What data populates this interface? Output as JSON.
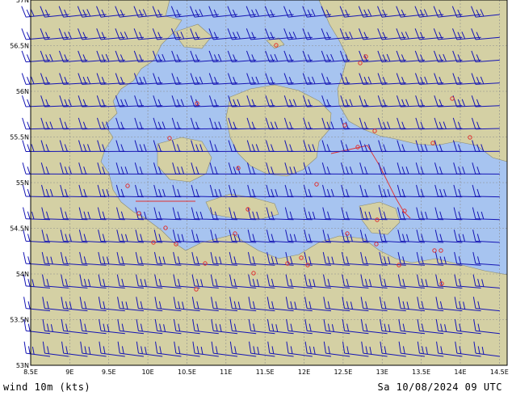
{
  "footer": {
    "left_label": "wind 10m (kts)",
    "right_label": "Sa 10/08/2024 09 UTC"
  },
  "axes": {
    "lon_ticks": [
      "8.5E",
      "9E",
      "9.5E",
      "10E",
      "10.5E",
      "11E",
      "11.5E",
      "12E",
      "12.5E",
      "13E",
      "13.5E",
      "14E",
      "14.5E"
    ],
    "lat_ticks": [
      "57N",
      "56.5N",
      "56N",
      "55.5N",
      "55N",
      "54.5N",
      "54N",
      "53.5N",
      "53N"
    ]
  },
  "colors": {
    "sea": "#a7c4f0",
    "land": "#d4d0a4",
    "barb": "#1414b4",
    "grid": "#8c8c8c",
    "border": "#e03030",
    "station": "#e03030"
  },
  "icons": {
    "wind_barb": "wind-barb-icon",
    "station": "station-circle-icon"
  }
}
